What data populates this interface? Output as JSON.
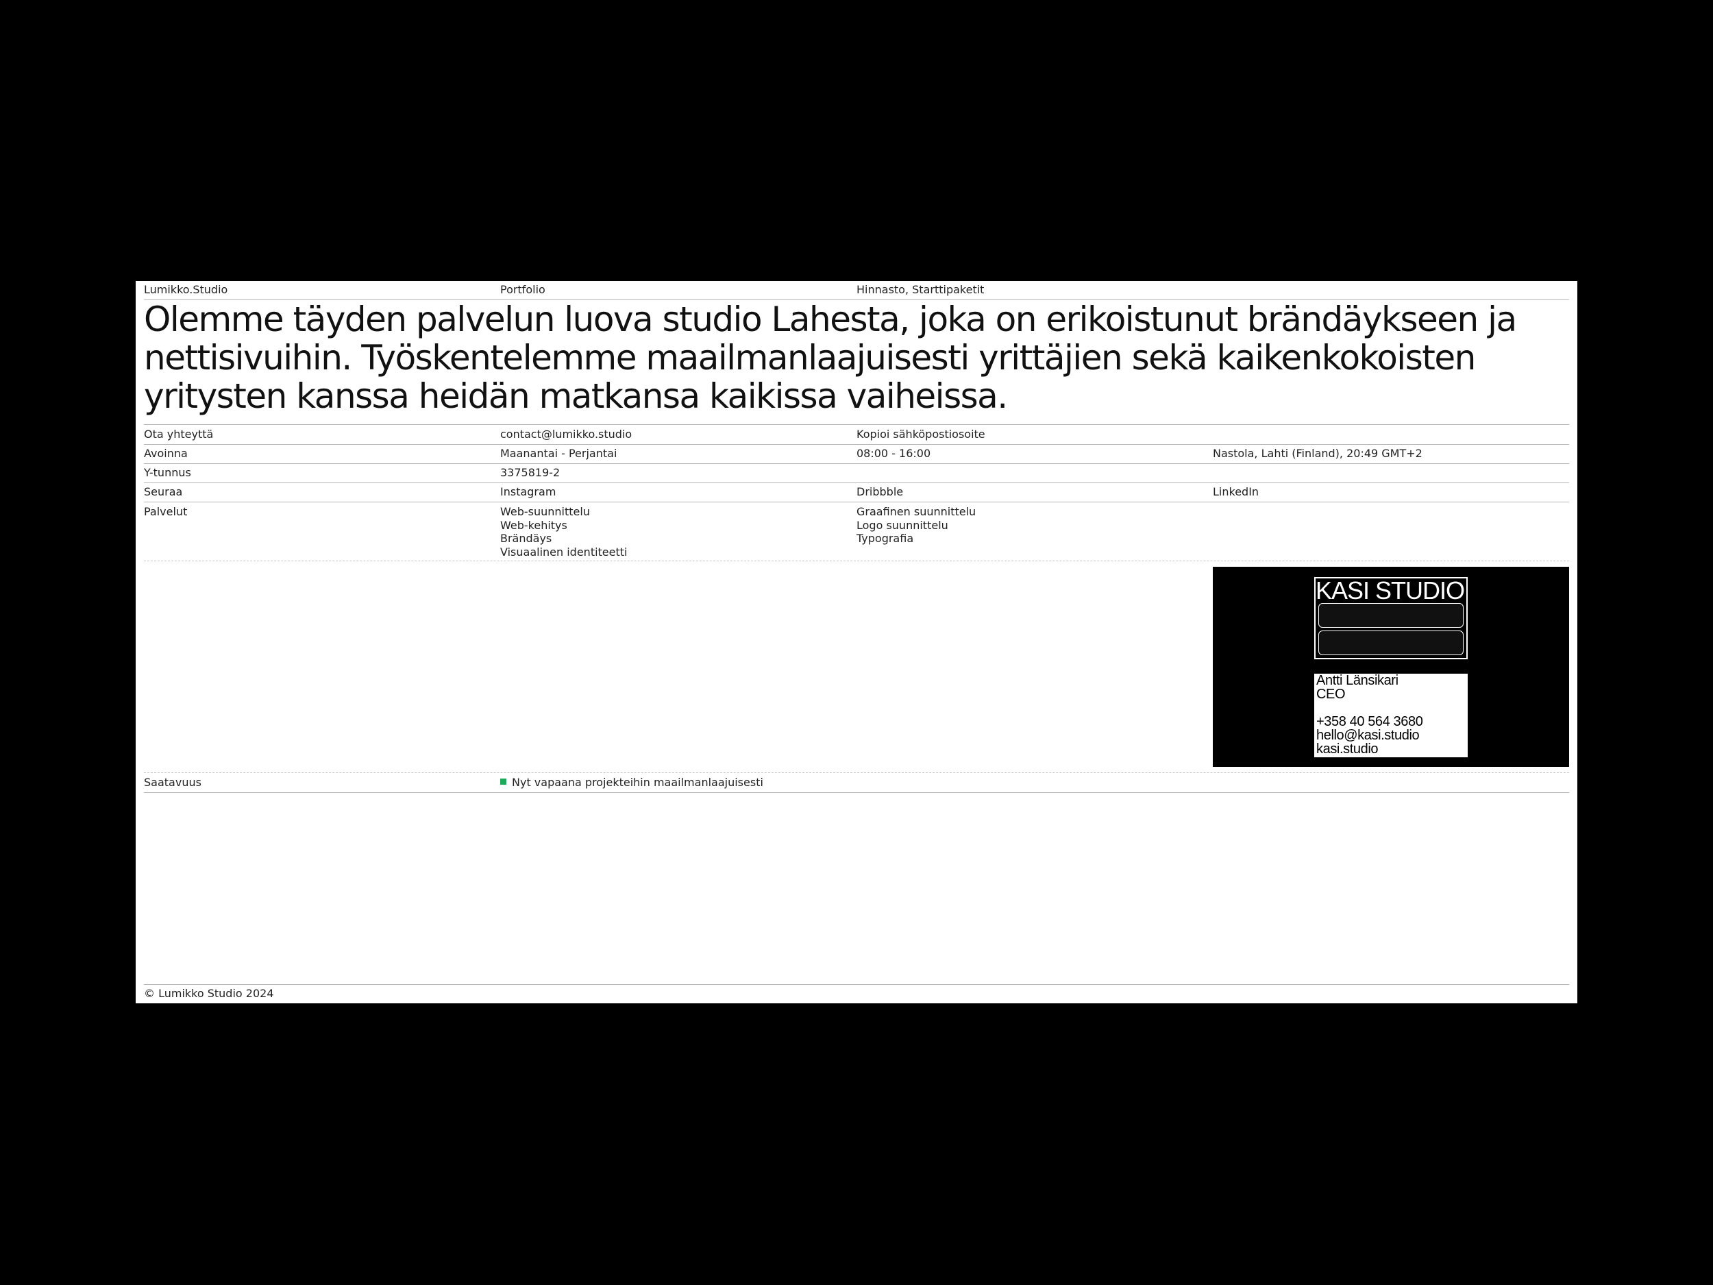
{
  "nav": {
    "brand": "Lumikko.Studio",
    "portfolio": "Portfolio",
    "pricing": "Hinnasto, Starttipaketit"
  },
  "intro": {
    "text": "Olemme täyden palvelun luova studio Lahesta, joka on erikoistunut brändäykseen ja nettisivuihin. Työskentelemme maailmanlaajuisesti yrittäjien sekä kaikenkokoisten yritysten kanssa heidän matkansa kaikissa vaiheissa."
  },
  "contact": {
    "label": "Ota yhteyttä",
    "email": "contact@lumikko.studio",
    "copy_label": "Kopioi sähköpostiosoite"
  },
  "hours": {
    "label": "Avoinna",
    "days": "Maanantai - Perjantai",
    "time": "08:00 - 16:00",
    "location": "Nastola, Lahti (Finland), 20:49 GMT+2"
  },
  "business_id": {
    "label": "Y-tunnus",
    "value": "3375819-2"
  },
  "follow": {
    "label": "Seuraa",
    "instagram": "Instagram",
    "dribbble": "Dribbble",
    "linkedin": "LinkedIn"
  },
  "services": {
    "label": "Palvelut",
    "col1": [
      "Web-suunnittelu",
      "Web-kehitys",
      "Brändäys",
      "Visuaalinen identiteetti"
    ],
    "col2": [
      "Graafinen suunnittelu",
      "Logo suunnittelu",
      "Typografia"
    ]
  },
  "business_card": {
    "logo_text": "KASI STUDIO",
    "name": "Antti Länsikari",
    "title": "CEO",
    "phone": "+358 40 564 3680",
    "email": "hello@kasi.studio",
    "website": "kasi.studio"
  },
  "availability": {
    "label": "Saatavuus",
    "status": "Nyt vapaana projekteihin maailmanlaajuisesti",
    "status_color": "#1fa85a"
  },
  "footer": {
    "copyright": "© Lumikko Studio 2024"
  }
}
